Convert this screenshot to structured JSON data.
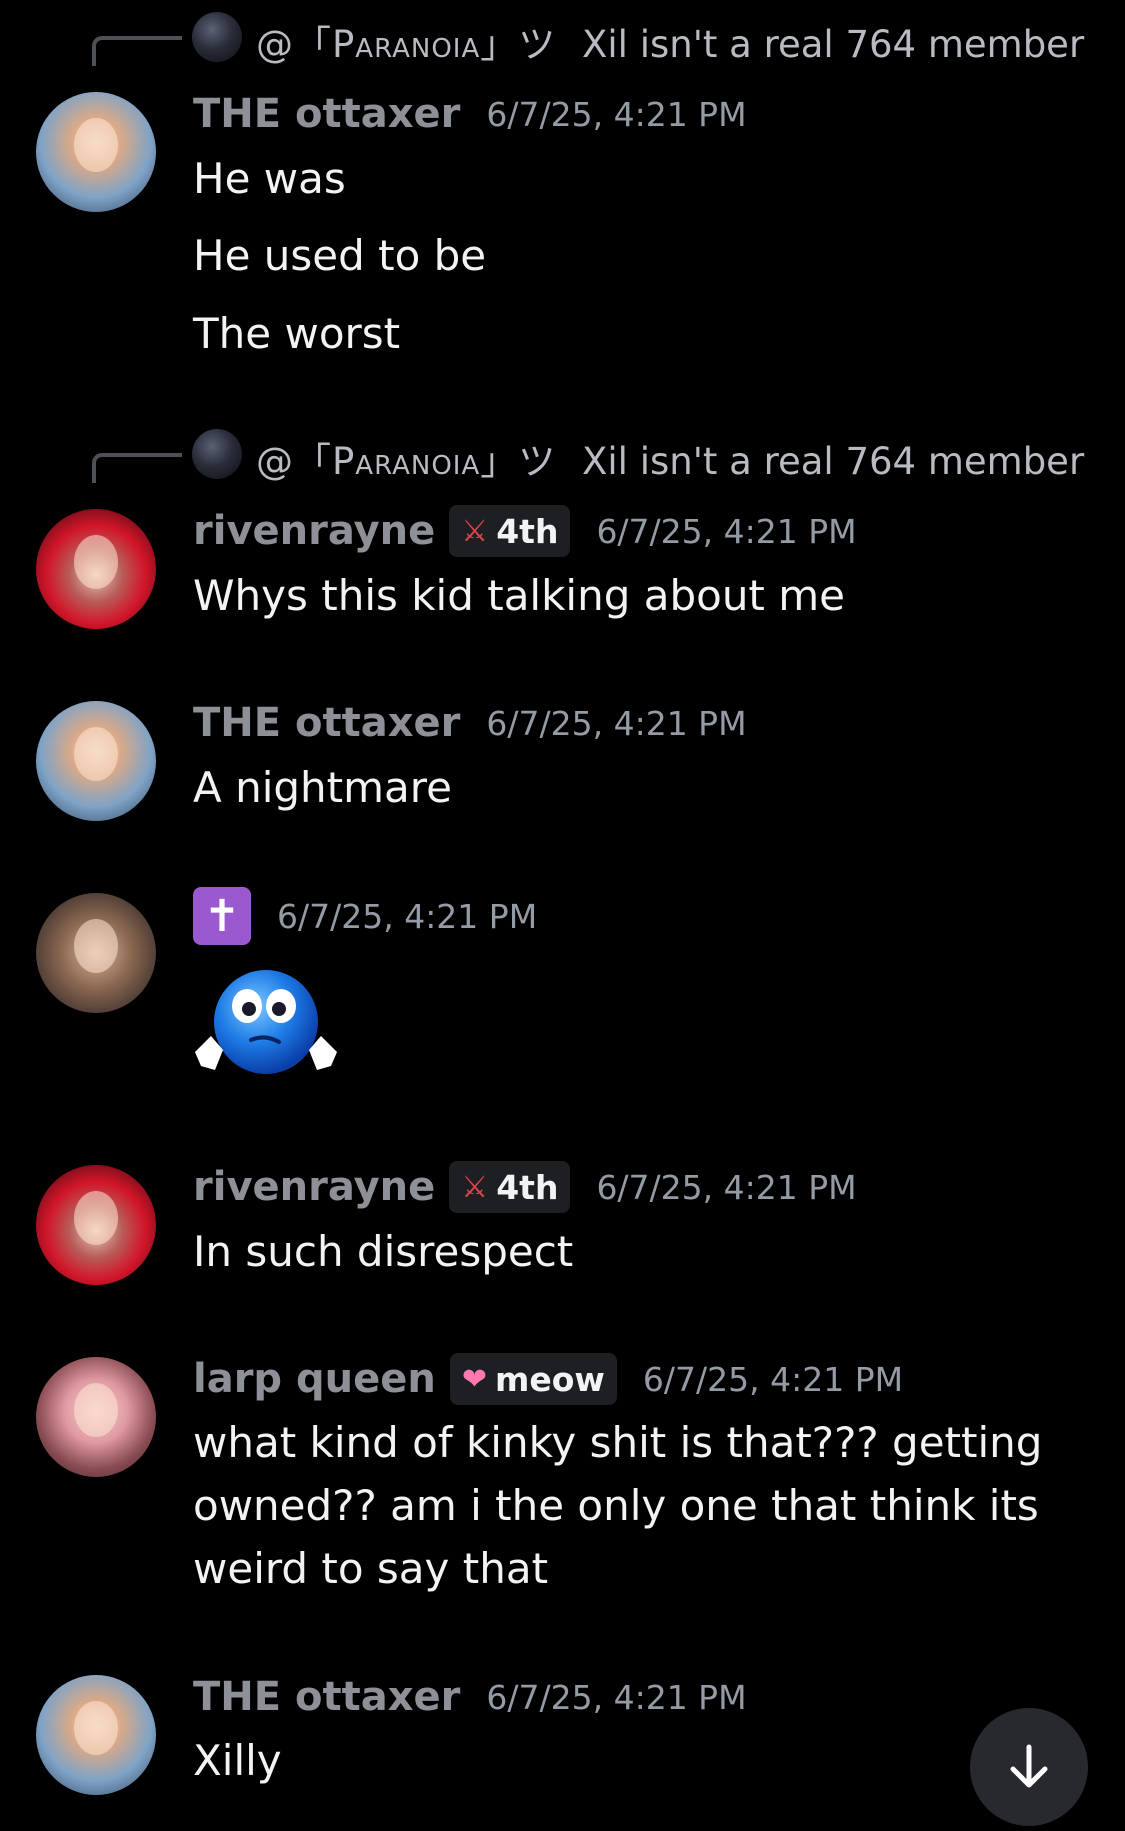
{
  "replies": [
    {
      "name": "@「Paranoia」ツ",
      "text": "Xil isn't a real 764 member"
    },
    {
      "name": "@「Paranoia」ツ",
      "text": "Xil isn't a real 764 member"
    }
  ],
  "messages": [
    {
      "username": "THE ottaxer",
      "timestamp": "6/7/25, 4:21 PM",
      "lines": [
        "He was",
        "He used to be",
        "The worst"
      ]
    },
    {
      "username": "rivenrayne",
      "tag": "4th",
      "timestamp": "6/7/25, 4:21 PM",
      "lines": [
        "Whys this kid talking about me"
      ]
    },
    {
      "username": "THE ottaxer",
      "timestamp": "6/7/25, 4:21 PM",
      "lines": [
        "A nightmare"
      ]
    },
    {
      "username": "✝",
      "timestamp": "6/7/25, 4:21 PM",
      "emoji": "shrugging-blue-face"
    },
    {
      "username": "rivenrayne",
      "tag": "4th",
      "timestamp": "6/7/25, 4:21 PM",
      "lines": [
        "In such disrespect"
      ]
    },
    {
      "username": "larp queen",
      "tag": "meow",
      "timestamp": "6/7/25, 4:21 PM",
      "lines": [
        "what kind of kinky shit is that??? getting",
        "owned?? am i the only one that think its",
        "weird to say that"
      ]
    },
    {
      "username": "THE ottaxer",
      "timestamp": "6/7/25, 4:21 PM",
      "lines": [
        "Xilly"
      ]
    }
  ],
  "icons": {
    "sword_tag": "crossed-swords-icon",
    "heart_tag": "heart-icon",
    "scroll_button": "arrow-down-icon"
  },
  "colors": {
    "background": "#000000",
    "username": "#8e9097",
    "message_text": "#f2f3f5",
    "timestamp": "#949ba4",
    "tag_background": "#1e1f22",
    "cross_badge": "#9b59d0",
    "scroll_button": "#27292e"
  }
}
